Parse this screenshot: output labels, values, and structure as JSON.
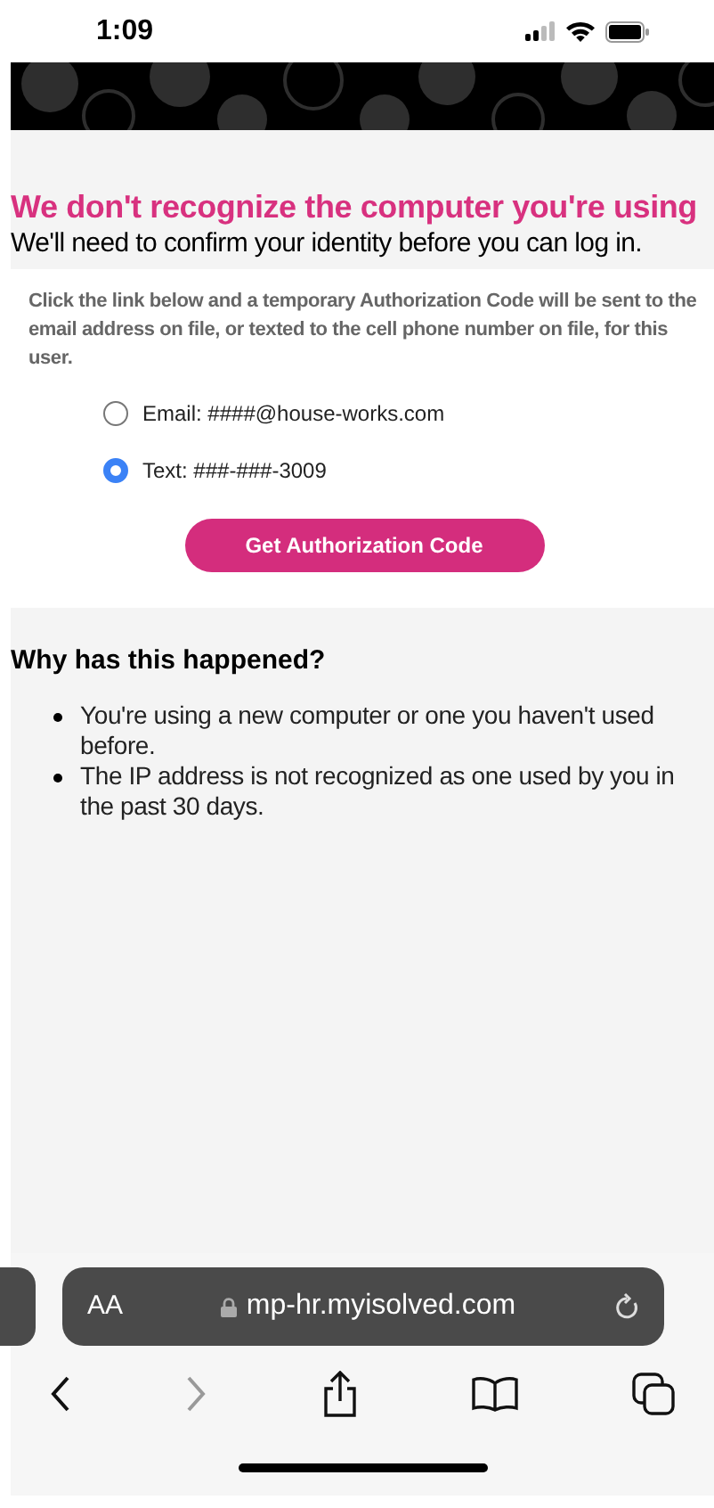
{
  "status_bar": {
    "time": "1:09"
  },
  "page": {
    "heading": "We don't recognize the computer you're using",
    "subheading": "We'll need to confirm your identity before you can log in.",
    "instructions": "Click the link below and a temporary Authorization Code will be sent to the email address on file, or texted to the cell phone number on file, for this user.",
    "options": [
      {
        "label": "Email: ####@house-works.com",
        "selected": false
      },
      {
        "label": "Text: ###-###-3009",
        "selected": true
      }
    ],
    "button": "Get Authorization Code",
    "why": {
      "title": "Why has this happened?",
      "items": [
        "You're using a new computer or one you haven't used before.",
        "The IP address is not recognized as one used by you in the past 30 days."
      ]
    }
  },
  "browser": {
    "text_size": "AA",
    "url": "mp-hr.myisolved.com"
  }
}
